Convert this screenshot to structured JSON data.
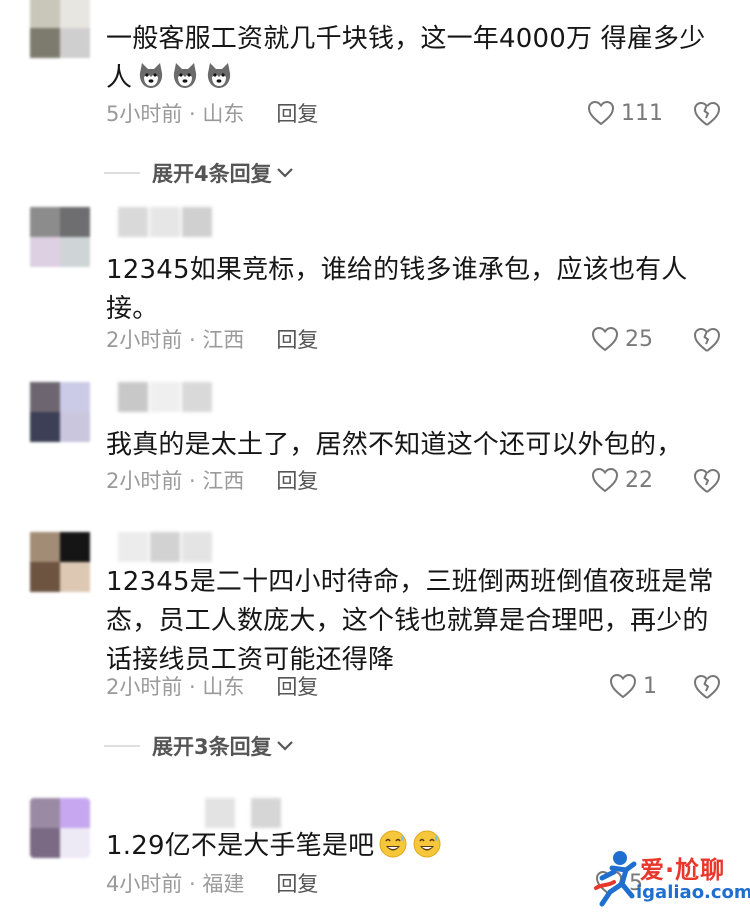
{
  "comments": [
    {
      "text": "一般客服工资就几千块钱，这一年4000万 得雇多少人",
      "time_location": "5小时前 · 山东",
      "reply_label": "回复",
      "likes": "111",
      "emoji_icons": [
        "husky-face-icon",
        "husky-face-icon",
        "husky-face-icon"
      ]
    },
    {
      "text": "12345如果竞标，谁给的钱多谁承包，应该也有人接。",
      "time_location": "2小时前 · 江西",
      "reply_label": "回复",
      "likes": "25"
    },
    {
      "text": "我真的是太土了，居然不知道这个还可以外包的，",
      "time_location": "2小时前 · 江西",
      "reply_label": "回复",
      "likes": "22"
    },
    {
      "text": "12345是二十四小时待命，三班倒两班倒值夜班是常态，员工人数庞大，这个钱也就算是合理吧，再少的话接线员工资可能还得降",
      "time_location": "2小时前 · 山东",
      "reply_label": "回复",
      "likes": "1"
    },
    {
      "text": "1.29亿不是大手笔是吧",
      "time_location": "4小时前 · 福建",
      "reply_label": "回复",
      "likes": "5",
      "emoji_icons": [
        "grinning-sweat-icon",
        "grinning-sweat-icon"
      ]
    }
  ],
  "expand_1": "展开4条回复",
  "expand_2": "展开3条回复",
  "watermark": {
    "title": "爱·尬聊",
    "url": "igaliao.com"
  },
  "colors": {
    "text": "#161616",
    "meta": "#9a9a9a",
    "reply": "#555555",
    "watermark_red": "#e8372b",
    "watermark_blue": "#1f6fd1"
  }
}
